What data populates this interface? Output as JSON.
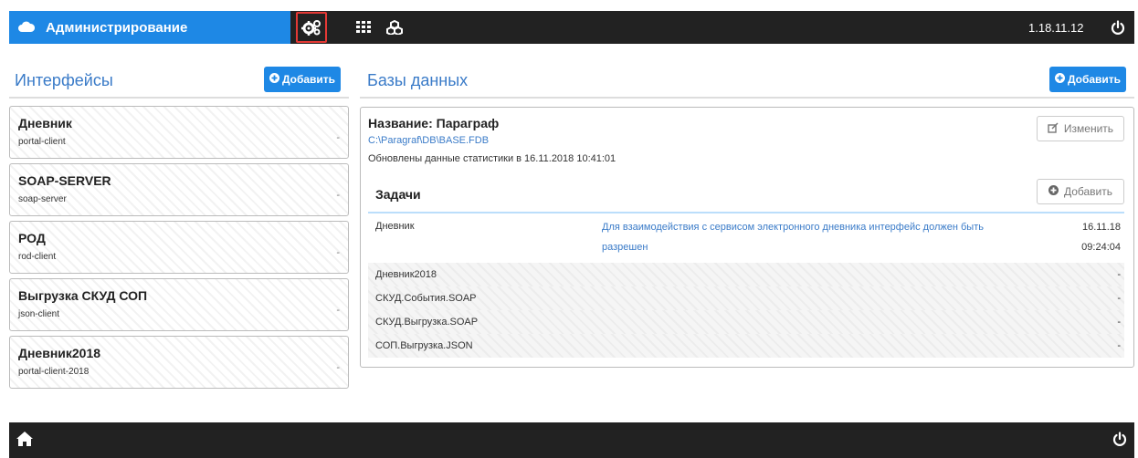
{
  "app": {
    "title": "Администрирование",
    "version": "1.18.11.12"
  },
  "toolbar_icons": [
    "cogs-icon",
    "grid-icon",
    "cubes-icon"
  ],
  "interfaces": {
    "title": "Интерфейсы",
    "add_label": "Добавить",
    "items": [
      {
        "title": "Дневник",
        "subtitle": "portal-client",
        "value": "-"
      },
      {
        "title": "SOAP-SERVER",
        "subtitle": "soap-server",
        "value": "-"
      },
      {
        "title": "РОД",
        "subtitle": "rod-client",
        "value": "-"
      },
      {
        "title": "Выгрузка СКУД СОП",
        "subtitle": "json-client",
        "value": "-"
      },
      {
        "title": "Дневник2018",
        "subtitle": "portal-client-2018",
        "value": "-"
      }
    ]
  },
  "databases": {
    "title": "Базы данных",
    "add_label": "Добавить",
    "db": {
      "name": "Название: Параграф",
      "path": "C:\\Paragraf\\DB\\BASE.FDB",
      "updated": "Обновлены данные статистики в 16.11.2018 10:41:01",
      "edit_label": "Изменить"
    },
    "tasks": {
      "title": "Задачи",
      "add_label": "Добавить",
      "rows": [
        {
          "name": "Дневник",
          "desc": "Для взаимодействия с сервисом электронного дневника интерфейс должен быть разрешен",
          "date": "16.11.18",
          "time": "09:24:04"
        },
        {
          "name": "Дневник2018",
          "desc": "",
          "date": "-"
        },
        {
          "name": "СКУД.События.SOAP",
          "desc": "",
          "date": "-"
        },
        {
          "name": "СКУД.Выгрузка.SOAP",
          "desc": "",
          "date": "-"
        },
        {
          "name": "СОП.Выгрузка.JSON",
          "desc": "",
          "date": "-"
        }
      ]
    }
  },
  "colors": {
    "accent": "#1e88e5",
    "dark": "#222222",
    "link": "#3a7bc8",
    "highlight": "#e53935"
  }
}
